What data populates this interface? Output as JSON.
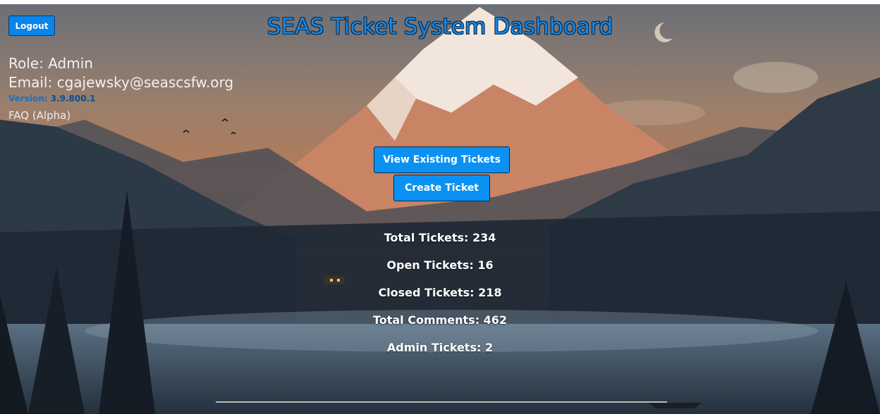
{
  "header": {
    "logout_label": "Logout",
    "title": "SEAS Ticket System Dashboard"
  },
  "user": {
    "role_text": "Role: Admin",
    "email_text": "Email: cgajewsky@seascsfw.org",
    "version_label": "Version: ",
    "version_number": "3.9.800.1",
    "faq_label": "FAQ (Alpha)"
  },
  "actions": {
    "view_label": "View Existing Tickets",
    "create_label": "Create Ticket"
  },
  "stats": {
    "total": "Total Tickets: 234",
    "open": "Open Tickets: 16",
    "closed": "Closed Tickets: 218",
    "comments": "Total Comments: 462",
    "admin": "Admin Tickets: 2"
  },
  "colors": {
    "accent": "#0a91f2",
    "title": "#1788e6"
  }
}
